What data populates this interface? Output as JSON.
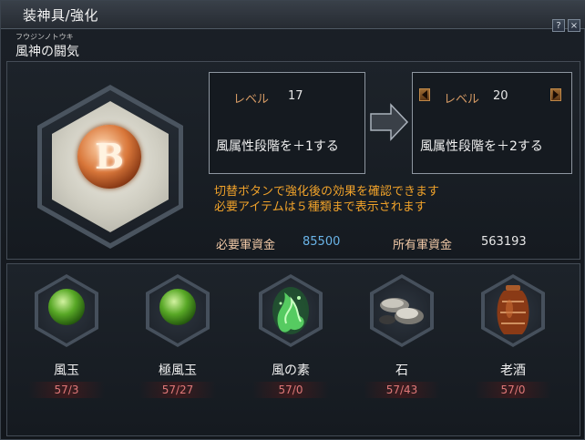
{
  "window": {
    "title": "装神具/強化",
    "help_label": "?",
    "close_label": "×"
  },
  "item": {
    "ruby": "フウジンノトウキ",
    "name": "風神の闘気",
    "emblem_letter": "B"
  },
  "current": {
    "level_label": "レベル",
    "level": "17",
    "effect": "風属性段階を＋1する"
  },
  "next": {
    "level_label": "レベル",
    "level": "20",
    "effect": "風属性段階を＋2する"
  },
  "notice": {
    "line1": "切替ボタンで強化後の効果を確認できます",
    "line2": "必要アイテムは５種類まで表示されます"
  },
  "funds": {
    "required_label": "必要軍資金",
    "required_value": "85500",
    "owned_label": "所有軍資金",
    "owned_value": "563193"
  },
  "materials": [
    {
      "name": "風玉",
      "count": "57/3",
      "icon": "green-orb-icon"
    },
    {
      "name": "極風玉",
      "count": "57/27",
      "icon": "green-orb-icon"
    },
    {
      "name": "風の素",
      "count": "57/0",
      "icon": "green-wind-spirit-icon"
    },
    {
      "name": "石",
      "count": "57/43",
      "icon": "stones-icon"
    },
    {
      "name": "老酒",
      "count": "57/0",
      "icon": "wine-jar-icon"
    }
  ],
  "colors": {
    "label_orange": "#d59a64",
    "notice_orange": "#f0a22a",
    "required_blue": "#6ab4e8",
    "count_red": "#e07878"
  }
}
